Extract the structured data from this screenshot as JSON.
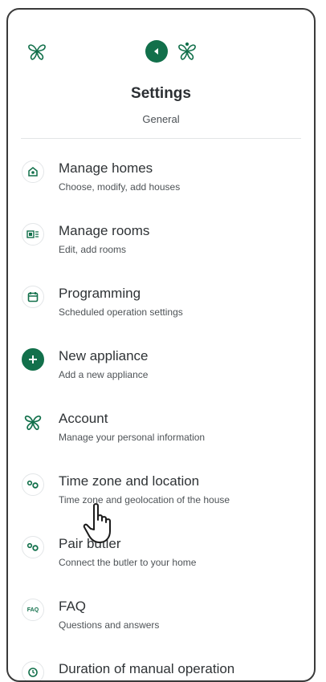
{
  "header": {
    "title": "Settings",
    "subtitle": "General"
  },
  "menu": [
    {
      "label": "Manage homes",
      "desc": "Choose, modify, add houses",
      "icon": "home-icon"
    },
    {
      "label": "Manage rooms",
      "desc": "Edit, add rooms",
      "icon": "rooms-icon"
    },
    {
      "label": "Programming",
      "desc": "Scheduled operation settings",
      "icon": "calendar-icon"
    },
    {
      "label": "New appliance",
      "desc": "Add a new appliance",
      "icon": "plus-icon"
    },
    {
      "label": "Account",
      "desc": "Manage your personal information",
      "icon": "butterfly-icon"
    },
    {
      "label": "Time zone and location",
      "desc": "Time zone and geolocation of the house",
      "icon": "location-icon"
    },
    {
      "label": "Pair butler",
      "desc": "Connect the butler to your home",
      "icon": "pair-icon"
    },
    {
      "label": "FAQ",
      "desc": "Questions and answers",
      "icon": "faq-icon"
    },
    {
      "label": "Duration of manual operation",
      "desc": "",
      "icon": "timer-icon"
    }
  ],
  "icons": {
    "faq_text": "FAQ"
  },
  "colors": {
    "accent": "#12704b",
    "frame": "#3a3a3a"
  }
}
